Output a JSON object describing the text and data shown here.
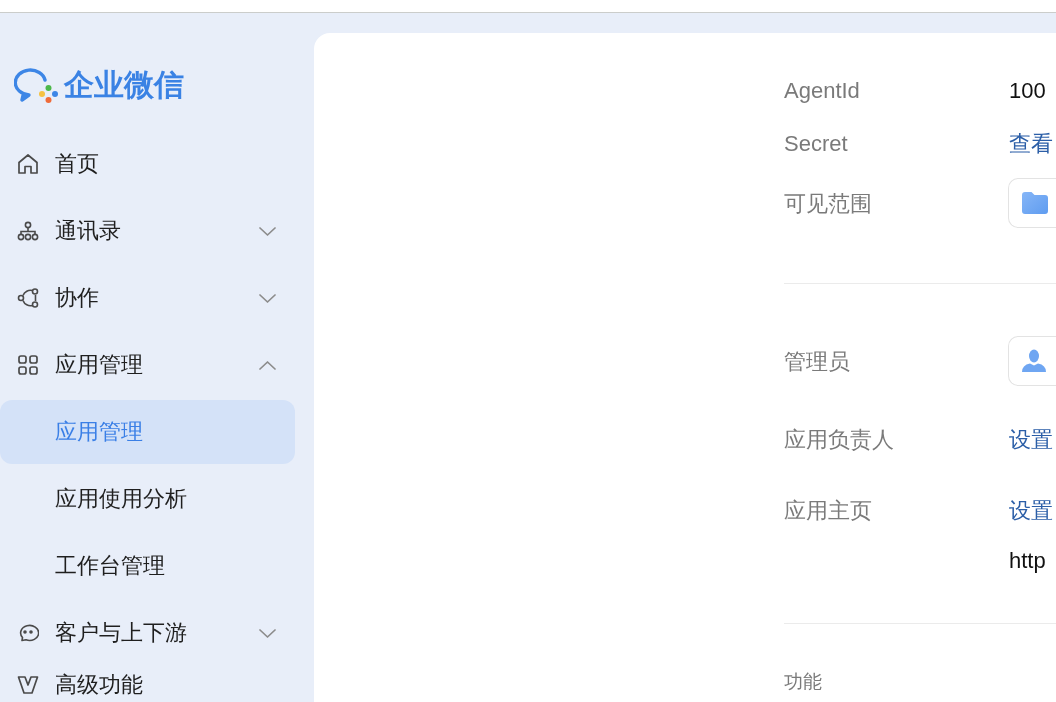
{
  "sidebar": {
    "logo": {
      "text": "企业微信"
    },
    "items": [
      {
        "label": "首页",
        "kind": "link",
        "selected": false
      },
      {
        "label": "通讯录",
        "kind": "group",
        "expanded": false,
        "selected": false
      },
      {
        "label": "协作",
        "kind": "group",
        "expanded": false,
        "selected": false
      },
      {
        "label": "应用管理",
        "kind": "group",
        "expanded": true,
        "selected": false,
        "children": [
          {
            "label": "应用管理",
            "selected": true
          },
          {
            "label": "应用使用分析",
            "selected": false
          },
          {
            "label": "工作台管理",
            "selected": false
          }
        ]
      },
      {
        "label": "客户与上下游",
        "kind": "group",
        "expanded": false,
        "selected": false
      },
      {
        "label": "高级功能",
        "kind": "link",
        "selected": false
      }
    ]
  },
  "main": {
    "sections": [
      {
        "fields": [
          {
            "label": "AgentId",
            "kind": "text",
            "value": "100"
          },
          {
            "label": "Secret",
            "kind": "link",
            "value": "查看"
          },
          {
            "label": "可见范围",
            "kind": "department"
          }
        ]
      },
      {
        "fields": [
          {
            "label": "管理员",
            "kind": "member"
          },
          {
            "label": "应用负责人",
            "kind": "link",
            "value": "设置"
          },
          {
            "label": "应用主页",
            "kind": "link",
            "value": "设置",
            "url": "http"
          }
        ]
      },
      {
        "title": "功能"
      }
    ]
  }
}
